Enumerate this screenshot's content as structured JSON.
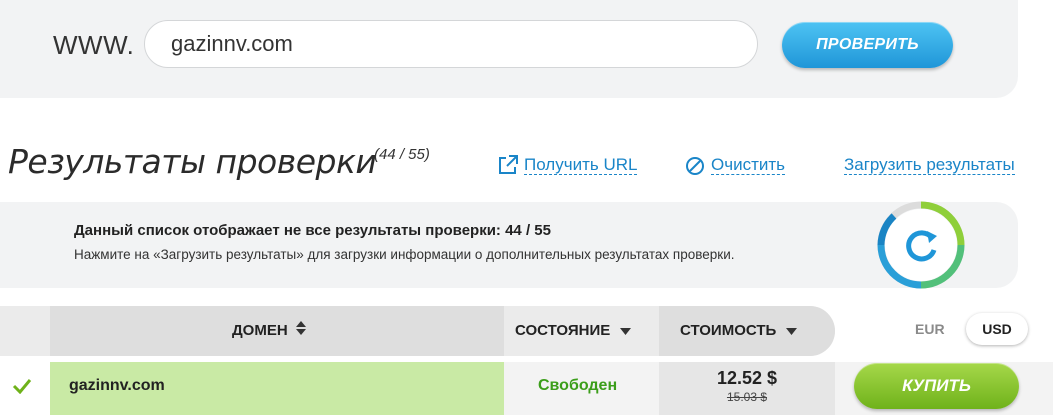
{
  "search": {
    "prefix": "WWW.",
    "value": "gazinnv.com",
    "button_label": "ПРОВЕРИТЬ"
  },
  "results": {
    "title": "Результаты проверки",
    "count": "(44 / 55)",
    "links": {
      "get_url": "Получить URL",
      "clear": "Очистить",
      "load": "Загрузить результаты"
    }
  },
  "info": {
    "title": "Данный список отображает не все результаты проверки: 44 / 55",
    "text": "Нажмите на «Загрузить результаты» для загрузки информации о дополнительных результатах проверки."
  },
  "table": {
    "headers": {
      "domain": "ДОМЕН",
      "status": "СОСТОЯНИЕ",
      "cost": "СТОИМОСТЬ"
    },
    "currency": {
      "eur": "EUR",
      "usd": "USD"
    },
    "rows": [
      {
        "domain": "gazinnv.com",
        "status": "Свободен",
        "price": "12.52 $",
        "old_price": "15.03 $",
        "buy_label": "КУПИТЬ"
      }
    ]
  },
  "colors": {
    "accent_blue": "#1f96d8",
    "link_blue": "#1a85c8",
    "available_green": "#3b9e1a",
    "buy_green": "#6fb21a",
    "row_highlight": "#c9eaa5"
  },
  "icons": {
    "external_link": "external-link-icon",
    "clear": "clear-circle-icon",
    "refresh": "refresh-icon",
    "sort": "sort-icon",
    "check": "check-icon"
  }
}
